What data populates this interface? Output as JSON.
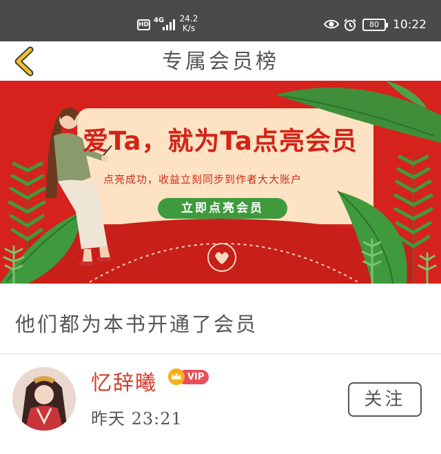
{
  "status_bar": {
    "hd": "HD",
    "network": "4G",
    "speed_value": "24.2",
    "speed_unit": "K/s",
    "battery": "80",
    "time": "10:22"
  },
  "header": {
    "title": "专属会员榜",
    "back_icon": "chevron-left-icon"
  },
  "banner": {
    "headline": "爱Ta，就为Ta点亮会员",
    "subtitle": "点亮成功，收益立刻同步到作者大大账户",
    "cta_label": "立即点亮会员",
    "colors": {
      "background": "#d6221c",
      "card": "#fde3c4",
      "cta": "#3f9a3e",
      "leaf": "#3f8f3a"
    }
  },
  "section": {
    "heading": "他们都为本书开通了会员"
  },
  "members": [
    {
      "name": "忆辞曦",
      "badge": "VIP",
      "time": "昨天 23:21",
      "follow_label": "关注"
    }
  ],
  "colors": {
    "accent_name": "#d53a28",
    "vip_pill": "#e7505a",
    "vip_crown": "#f5b21d",
    "text": "#555555",
    "status_bar": "#4a4a4a"
  }
}
